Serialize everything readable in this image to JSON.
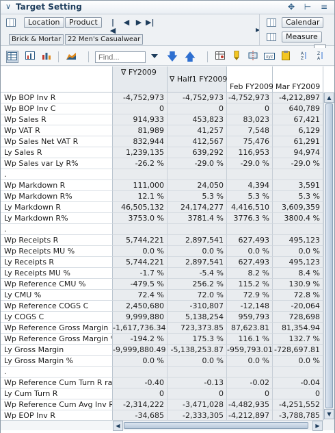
{
  "window": {
    "title": "Target Setting",
    "icons": [
      "chevron-down-icon",
      "move-icon",
      "pin-icon",
      "menu-icon"
    ]
  },
  "selector": {
    "location_label": "Location",
    "product_label": "Product",
    "location_value": "Brick & Mortar",
    "product_value": "22 Men's Casualwear",
    "calendar_label": "Calendar",
    "measure_label": "Measure"
  },
  "toolbar": {
    "find_placeholder": "Find..."
  },
  "grid": {
    "columns": [
      {
        "label": "∇ FY2009"
      },
      {
        "label": "∇ Half1 FY2009"
      },
      {
        "label": "Feb FY2009"
      },
      {
        "label": "Mar FY2009"
      }
    ],
    "rows": [
      {
        "label": "Wp BOP Inv R",
        "values": [
          "-4,752,973",
          "-4,752,973",
          "-4,752,973",
          "-4,212,897"
        ]
      },
      {
        "label": "Wp BOP Inv C",
        "values": [
          "0",
          "0",
          "0",
          "640,789"
        ]
      },
      {
        "label": "Wp Sales R",
        "values": [
          "914,933",
          "453,823",
          "83,023",
          "67,421"
        ]
      },
      {
        "label": "Wp VAT R",
        "values": [
          "81,989",
          "41,257",
          "7,548",
          "6,129"
        ]
      },
      {
        "label": "Wp Sales Net VAT R",
        "values": [
          "832,944",
          "412,567",
          "75,476",
          "61,291"
        ]
      },
      {
        "label": "Ly Sales R",
        "values": [
          "1,239,135",
          "639,292",
          "116,953",
          "94,974"
        ]
      },
      {
        "label": "Wp Sales var Ly R%",
        "values": [
          "-26.2 %",
          "-29.0 %",
          "-29.0 %",
          "-29.0 %"
        ]
      },
      {
        "label": ".",
        "values": [
          "",
          "",
          "",
          ""
        ]
      },
      {
        "label": "Wp Markdown R",
        "values": [
          "111,000",
          "24,050",
          "4,394",
          "3,591"
        ]
      },
      {
        "label": "Wp Markdown R%",
        "values": [
          "12.1 %",
          "5.3 %",
          "5.3 %",
          "5.3 %"
        ]
      },
      {
        "label": "Ly Markdown R",
        "values": [
          "46,505,132",
          "24,174,277",
          "4,416,510",
          "3,609,359"
        ]
      },
      {
        "label": "Ly Markdown R%",
        "values": [
          "3753.0 %",
          "3781.4 %",
          "3776.3 %",
          "3800.4 %"
        ]
      },
      {
        "label": ".",
        "values": [
          "",
          "",
          "",
          ""
        ]
      },
      {
        "label": "Wp Receipts R",
        "values": [
          "5,744,221",
          "2,897,541",
          "627,493",
          "495,123"
        ]
      },
      {
        "label": "Wp Receipts MU %",
        "values": [
          "0.0 %",
          "0.0 %",
          "0.0 %",
          "0.0 %"
        ]
      },
      {
        "label": "Ly Receipts R",
        "values": [
          "5,744,221",
          "2,897,541",
          "627,493",
          "495,123"
        ]
      },
      {
        "label": "Ly Receipts MU %",
        "values": [
          "-1.7 %",
          "-5.4 %",
          "8.2 %",
          "8.4 %"
        ]
      },
      {
        "label": "Wp Reference CMU %",
        "values": [
          "-479.5 %",
          "256.2 %",
          "115.2 %",
          "130.9 %"
        ]
      },
      {
        "label": "Ly CMU %",
        "values": [
          "72.4 %",
          "72.0 %",
          "72.9 %",
          "72.8 %"
        ]
      },
      {
        "label": "Wp Reference COGS C",
        "values": [
          "2,450,680",
          "-310,807",
          "-12,148",
          "-20,064"
        ]
      },
      {
        "label": "Ly COGS C",
        "values": [
          "9,999,880",
          "5,138,254",
          "959,793",
          "728,698"
        ]
      },
      {
        "label": "Wp Reference Gross Margin",
        "values": [
          "-1,617,736.34",
          "723,373.85",
          "87,623.81",
          "81,354.94"
        ]
      },
      {
        "label": "Wp Reference Gross Margin %",
        "values": [
          "-194.2 %",
          "175.3 %",
          "116.1 %",
          "132.7 %"
        ]
      },
      {
        "label": "Ly Gross Margin",
        "values": [
          "-9,999,880.49",
          "-5,138,253.87",
          "-959,793.01",
          "-728,697.81"
        ]
      },
      {
        "label": "Ly Gross Margin %",
        "values": [
          "0.0 %",
          "0.0 %",
          "0.0 %",
          "0.0 %"
        ]
      },
      {
        "label": ".",
        "values": [
          "",
          "",
          "",
          ""
        ]
      },
      {
        "label": "Wp Reference Cum Turn R ratio",
        "values": [
          "-0.40",
          "-0.13",
          "-0.02",
          "-0.04"
        ]
      },
      {
        "label": "Ly Cum Turn R",
        "values": [
          "0",
          "0",
          "0",
          "0"
        ]
      },
      {
        "label": "Wp Reference Cum Avg Inv R",
        "values": [
          "-2,314,222",
          "-3,471,028",
          "-4,482,935",
          "-4,251,552"
        ]
      },
      {
        "label": "Wp EOP Inv R",
        "values": [
          "-34,685",
          "-2,333,305",
          "-4,212,897",
          "-3,788,785"
        ]
      }
    ]
  }
}
